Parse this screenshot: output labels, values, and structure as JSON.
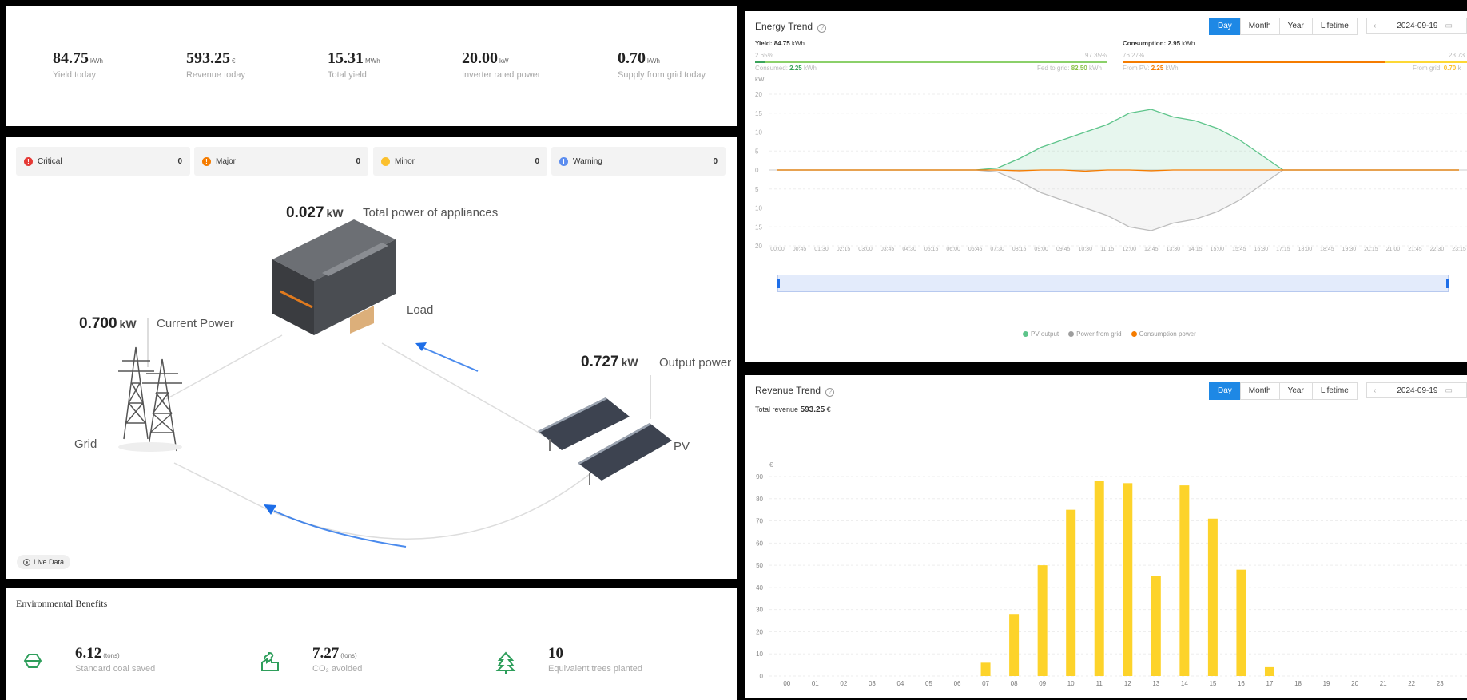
{
  "kpis": [
    {
      "value": "84.75",
      "unit": "kWh",
      "label": "Yield today"
    },
    {
      "value": "593.25",
      "unit": "€",
      "label": "Revenue today"
    },
    {
      "value": "15.31",
      "unit": "MWh",
      "label": "Total yield"
    },
    {
      "value": "20.00",
      "unit": "kW",
      "label": "Inverter rated power"
    },
    {
      "value": "0.70",
      "unit": "kWh",
      "label": "Supply from grid today"
    }
  ],
  "alarms": [
    {
      "label": "Critical",
      "count": "0",
      "color": "#e53935",
      "glyph": "!"
    },
    {
      "label": "Major",
      "count": "0",
      "color": "#f57c00",
      "glyph": "!"
    },
    {
      "label": "Minor",
      "count": "0",
      "color": "#fbc02d",
      "glyph": ""
    },
    {
      "label": "Warning",
      "count": "0",
      "color": "#5c8def",
      "glyph": "i"
    }
  ],
  "flow": {
    "load_value": "0.027",
    "load_unit": "kW",
    "load_label": "Total power of appliances",
    "load_name": "Load",
    "grid_value": "0.700",
    "grid_unit": "kW",
    "grid_label": "Current Power",
    "grid_name": "Grid",
    "pv_value": "0.727",
    "pv_unit": "kW",
    "pv_label": "Output power",
    "pv_name": "PV",
    "live_label": "Live Data"
  },
  "env": {
    "title": "Environmental Benefits",
    "items": [
      {
        "value": "6.12",
        "unit": "(tons)",
        "label": "Standard coal saved",
        "icon": "coal-icon"
      },
      {
        "value": "7.27",
        "unit": "(tons)",
        "label": "CO₂ avoided",
        "icon": "factory-icon"
      },
      {
        "value": "10",
        "unit": "",
        "label": "Equivalent trees planted",
        "icon": "tree-icon"
      }
    ]
  },
  "energy": {
    "title": "Energy Trend",
    "tabs": [
      "Day",
      "Month",
      "Year",
      "Lifetime"
    ],
    "active_tab": "Day",
    "date": "2024-09-19",
    "yield_label": "Yield:",
    "yield_value": "84.75",
    "yield_unit": "kWh",
    "yield_pct_left": "2.65%",
    "yield_pct_right": "97.35%",
    "consumed_label": "Consumed:",
    "consumed_value": "2.25",
    "consumed_unit": "kWh",
    "fed_label": "Fed to grid:",
    "fed_value": "82.50",
    "fed_unit": "kWh",
    "cons_label": "Consumption:",
    "cons_value": "2.95",
    "cons_unit": "kWh",
    "cons_pct_left": "76.27%",
    "cons_pct_right": "23.73",
    "frompv_label": "From PV:",
    "frompv_value": "2.25",
    "frompv_unit": "kWh",
    "fromgrid_label": "From grid:",
    "fromgrid_value": "0.70",
    "fromgrid_unit": "k",
    "y_unit": "kW",
    "legend": [
      "PV output",
      "Power from grid",
      "Consumption power"
    ],
    "legend_colors": [
      "#5dc48a",
      "#9e9e9e",
      "#f57c00"
    ]
  },
  "revenue": {
    "title": "Revenue Trend",
    "tabs": [
      "Day",
      "Month",
      "Year",
      "Lifetime"
    ],
    "active_tab": "Day",
    "date": "2024-09-19",
    "total_label": "Total revenue",
    "total_value": "593.25",
    "total_unit": "€",
    "y_unit": "€"
  },
  "chart_data": [
    {
      "type": "area",
      "title": "Energy Trend",
      "ylabel": "kW",
      "ylim": [
        -20,
        20
      ],
      "yticks": [
        "20",
        "15",
        "10",
        "5",
        "0",
        "5",
        "10",
        "15",
        "20"
      ],
      "x": [
        "00:00",
        "00:45",
        "01:30",
        "02:15",
        "03:00",
        "03:45",
        "04:30",
        "05:15",
        "06:00",
        "06:45",
        "07:30",
        "08:15",
        "09:00",
        "09:45",
        "10:30",
        "11:15",
        "12:00",
        "12:45",
        "13:30",
        "14:15",
        "15:00",
        "15:45",
        "16:30",
        "17:15",
        "18:00",
        "18:45",
        "19:30",
        "20:15",
        "21:00",
        "21:45",
        "22:30",
        "23:15"
      ],
      "series": [
        {
          "name": "PV output",
          "values": [
            0,
            0,
            0,
            0,
            0,
            0,
            0,
            0,
            0,
            0,
            0.5,
            3,
            6,
            8,
            10,
            12,
            15,
            16,
            14,
            13,
            11,
            8,
            4,
            0,
            0,
            0,
            0,
            0,
            0,
            0,
            0,
            0
          ]
        },
        {
          "name": "Power from grid",
          "values": [
            0,
            0,
            0,
            0,
            0,
            0,
            0,
            0,
            0,
            0,
            -0.5,
            -3,
            -6,
            -8,
            -10,
            -12,
            -15,
            -16,
            -14,
            -13,
            -11,
            -8,
            -4,
            0,
            0,
            0,
            0,
            0,
            0,
            0,
            0,
            0
          ]
        },
        {
          "name": "Consumption power",
          "values": [
            0,
            0,
            0,
            0,
            0,
            0,
            0,
            0,
            0,
            0,
            0,
            -0.2,
            0,
            0,
            -0.3,
            0,
            0,
            -0.2,
            0,
            0,
            0,
            0,
            0,
            0,
            0,
            0,
            0,
            0,
            0,
            0,
            0,
            0
          ]
        }
      ]
    },
    {
      "type": "bar",
      "title": "Revenue Trend",
      "ylabel": "€",
      "ylim": [
        0,
        90
      ],
      "yticks": [
        0,
        10,
        20,
        30,
        40,
        50,
        60,
        70,
        80,
        90
      ],
      "categories": [
        "00",
        "01",
        "02",
        "03",
        "04",
        "05",
        "06",
        "07",
        "08",
        "09",
        "10",
        "11",
        "12",
        "13",
        "14",
        "15",
        "16",
        "17",
        "18",
        "19",
        "20",
        "21",
        "22",
        "23"
      ],
      "values": [
        0,
        0,
        0,
        0,
        0,
        0,
        0,
        6,
        28,
        50,
        75,
        88,
        87,
        45,
        86,
        71,
        48,
        4,
        0,
        0,
        0,
        0,
        0,
        0
      ]
    }
  ]
}
